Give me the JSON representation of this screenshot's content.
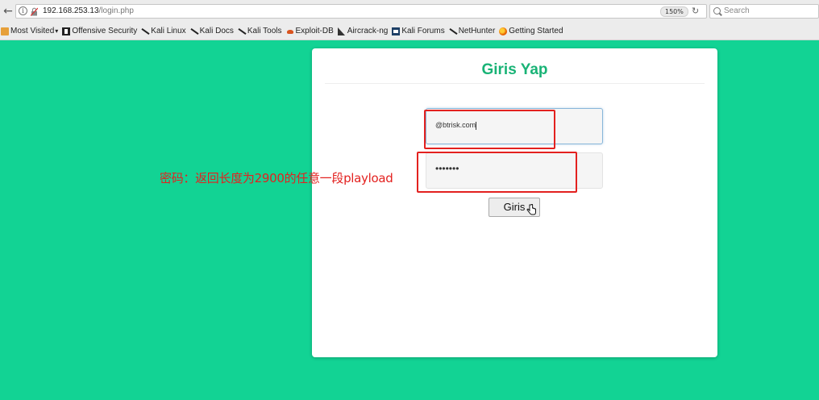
{
  "browser": {
    "url_host": "192.168.253.13",
    "url_path": "/login.php",
    "zoom": "150%",
    "search_placeholder": "Search"
  },
  "bookmarks": [
    {
      "label": "Most Visited",
      "icon": "folder-icon"
    },
    {
      "label": "Offensive Security",
      "icon": "offsec-icon"
    },
    {
      "label": "Kali Linux",
      "icon": "kali-dragon-icon"
    },
    {
      "label": "Kali Docs",
      "icon": "kali-dragon-icon"
    },
    {
      "label": "Kali Tools",
      "icon": "kali-dragon-icon"
    },
    {
      "label": "Exploit-DB",
      "icon": "exploit-db-icon"
    },
    {
      "label": "Aircrack-ng",
      "icon": "aircrack-icon"
    },
    {
      "label": "Kali Forums",
      "icon": "forum-icon"
    },
    {
      "label": "NetHunter",
      "icon": "kali-dragon-icon"
    },
    {
      "label": "Getting Started",
      "icon": "firefox-icon"
    }
  ],
  "login": {
    "title": "Giris Yap",
    "email_value": "@btrisk.com",
    "password_value": "•••••••",
    "submit_label": "Giris"
  },
  "annotation": {
    "note": "密码：返回长度为2900的任意一段playload",
    "color": "#e3211f"
  },
  "colors": {
    "page_background": "#12d394",
    "title": "#19b376"
  }
}
